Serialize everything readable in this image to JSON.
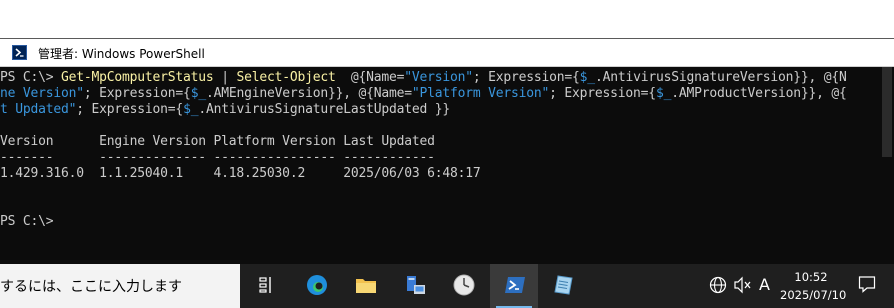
{
  "window": {
    "title": "管理者: Windows PowerShell"
  },
  "console": {
    "lines": [
      [
        {
          "t": "PS C:\\> ",
          "c": "def"
        },
        {
          "t": "Get-MpComputerStatus",
          "c": "cmd"
        },
        {
          "t": " | ",
          "c": "def"
        },
        {
          "t": "Select-Object",
          "c": "cmd"
        },
        {
          "t": "  @{Name=",
          "c": "def"
        },
        {
          "t": "\"Version\"",
          "c": "str"
        },
        {
          "t": "; Expression={",
          "c": "def"
        },
        {
          "t": "$_",
          "c": "var"
        },
        {
          "t": ".AntivirusSignatureVersion}}, @{N",
          "c": "def"
        }
      ],
      [
        {
          "t": "ne Version\"",
          "c": "str"
        },
        {
          "t": "; Expression={",
          "c": "def"
        },
        {
          "t": "$_",
          "c": "var"
        },
        {
          "t": ".AMEngineVersion}}, @{Name=",
          "c": "def"
        },
        {
          "t": "\"Platform Version\"",
          "c": "str"
        },
        {
          "t": "; Expression={",
          "c": "def"
        },
        {
          "t": "$_",
          "c": "var"
        },
        {
          "t": ".AMProductVersion}}, @{",
          "c": "def"
        }
      ],
      [
        {
          "t": "t Updated\"",
          "c": "str"
        },
        {
          "t": "; Expression={",
          "c": "def"
        },
        {
          "t": "$_",
          "c": "var"
        },
        {
          "t": ".AntivirusSignatureLastUpdated }}",
          "c": "def"
        }
      ],
      [],
      [
        {
          "t": "Version      Engine Version Platform Version Last Updated",
          "c": "def"
        }
      ],
      [
        {
          "t": "-------      -------------- ---------------- ------------",
          "c": "def"
        }
      ],
      [
        {
          "t": "1.429.316.0  1.1.25040.1    4.18.25030.2     2025/06/03 6:48:17",
          "c": "def"
        }
      ],
      [],
      [],
      [
        {
          "t": "PS C:\\>",
          "c": "def"
        }
      ]
    ]
  },
  "taskbar": {
    "search_text": "するには、ここに入力します",
    "apps": [
      {
        "name": "task-view",
        "label": "Task View"
      },
      {
        "name": "edge",
        "label": "Microsoft Edge"
      },
      {
        "name": "file-explorer",
        "label": "File Explorer"
      },
      {
        "name": "server-manager",
        "label": "Server Manager"
      },
      {
        "name": "clock-app",
        "label": "Clock"
      },
      {
        "name": "powershell",
        "label": "Windows PowerShell"
      },
      {
        "name": "notepad",
        "label": "Notepad"
      }
    ],
    "ime_indicator": "A",
    "time": "10:52",
    "date": "2025/07/10"
  },
  "colors": {
    "console_bg": "#0c0c0c",
    "command": "#f9f1a5",
    "string": "#3a96dd",
    "default": "#cccccc"
  }
}
